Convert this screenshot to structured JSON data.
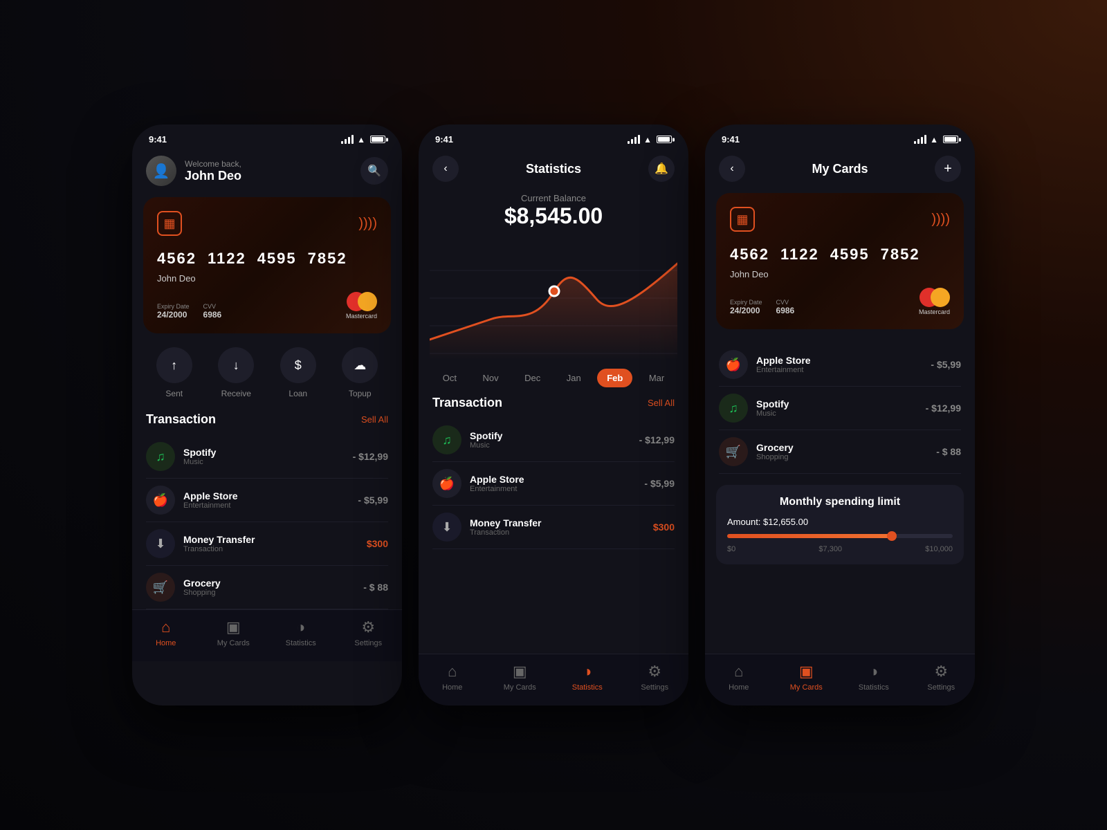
{
  "phone1": {
    "statusBar": {
      "time": "9:41"
    },
    "header": {
      "welcome": "Welcome back,",
      "name": "John Deo"
    },
    "card": {
      "number": [
        "4562",
        "1122",
        "4595",
        "7852"
      ],
      "holder": "John Deo",
      "expiry_label": "Expiry Date",
      "expiry_value": "24/2000",
      "cvv_label": "CVV",
      "cvv_value": "6986",
      "brand": "Mastercard"
    },
    "actions": [
      {
        "label": "Sent",
        "icon": "↑"
      },
      {
        "label": "Receive",
        "icon": "↓"
      },
      {
        "label": "Loan",
        "icon": "$"
      },
      {
        "label": "Topup",
        "icon": "↑☁"
      }
    ],
    "section": {
      "title": "Transaction",
      "sellAll": "Sell All"
    },
    "transactions": [
      {
        "name": "Spotify",
        "sub": "Music",
        "amount": "- $12,99",
        "type": "spotify"
      },
      {
        "name": "Apple Store",
        "sub": "Entertainment",
        "amount": "- $5,99",
        "type": "apple"
      },
      {
        "name": "Money Transfer",
        "sub": "Transaction",
        "amount": "$300",
        "type": "transfer",
        "red": true
      },
      {
        "name": "Grocery",
        "sub": "Shopping",
        "amount": "- $ 88",
        "type": "grocery"
      }
    ],
    "nav": [
      {
        "label": "Home",
        "active": true
      },
      {
        "label": "My Cards",
        "active": false
      },
      {
        "label": "Statistics",
        "active": false
      },
      {
        "label": "Settings",
        "active": false
      }
    ]
  },
  "phone2": {
    "statusBar": {
      "time": "9:41"
    },
    "header": {
      "title": "Statistics",
      "back": "‹",
      "notif": "🔔"
    },
    "balance": {
      "label": "Current Balance",
      "amount": "$8,545.00"
    },
    "months": [
      "Oct",
      "Nov",
      "Dec",
      "Jan",
      "Feb",
      "Mar"
    ],
    "activeMonth": "Feb",
    "section": {
      "title": "Transaction",
      "sellAll": "Sell All"
    },
    "transactions": [
      {
        "name": "Spotify",
        "sub": "Music",
        "amount": "- $12,99",
        "type": "spotify"
      },
      {
        "name": "Apple Store",
        "sub": "Entertainment",
        "amount": "- $5,99",
        "type": "apple"
      },
      {
        "name": "Money Transfer",
        "sub": "Transaction",
        "amount": "$300",
        "type": "transfer",
        "red": true
      }
    ],
    "nav": [
      {
        "label": "Home",
        "active": false
      },
      {
        "label": "My Cards",
        "active": false
      },
      {
        "label": "Statistics",
        "active": true
      },
      {
        "label": "Settings",
        "active": false
      }
    ]
  },
  "phone3": {
    "statusBar": {
      "time": "9:41"
    },
    "header": {
      "title": "My Cards",
      "back": "‹",
      "add": "+"
    },
    "card": {
      "number": [
        "4562",
        "1122",
        "4595",
        "7852"
      ],
      "holder": "John Deo",
      "expiry_label": "Expiry Date",
      "expiry_value": "24/2000",
      "cvv_label": "CVV",
      "cvv_value": "6986",
      "brand": "Mastercard"
    },
    "transactions": [
      {
        "name": "Apple Store",
        "sub": "Entertainment",
        "amount": "- $5,99",
        "type": "apple"
      },
      {
        "name": "Spotify",
        "sub": "Music",
        "amount": "- $12,99",
        "type": "spotify"
      },
      {
        "name": "Grocery",
        "sub": "Shopping",
        "amount": "- $ 88",
        "type": "grocery"
      }
    ],
    "spending": {
      "title": "Monthly spending limit",
      "amount": "Amount: $12,655.00",
      "min": "$0",
      "mid": "$7,300",
      "max": "$10,000",
      "percent": 73
    },
    "nav": [
      {
        "label": "Home",
        "active": false
      },
      {
        "label": "My Cards",
        "active": true
      },
      {
        "label": "Statistics",
        "active": false
      },
      {
        "label": "Settings",
        "active": false
      }
    ]
  }
}
